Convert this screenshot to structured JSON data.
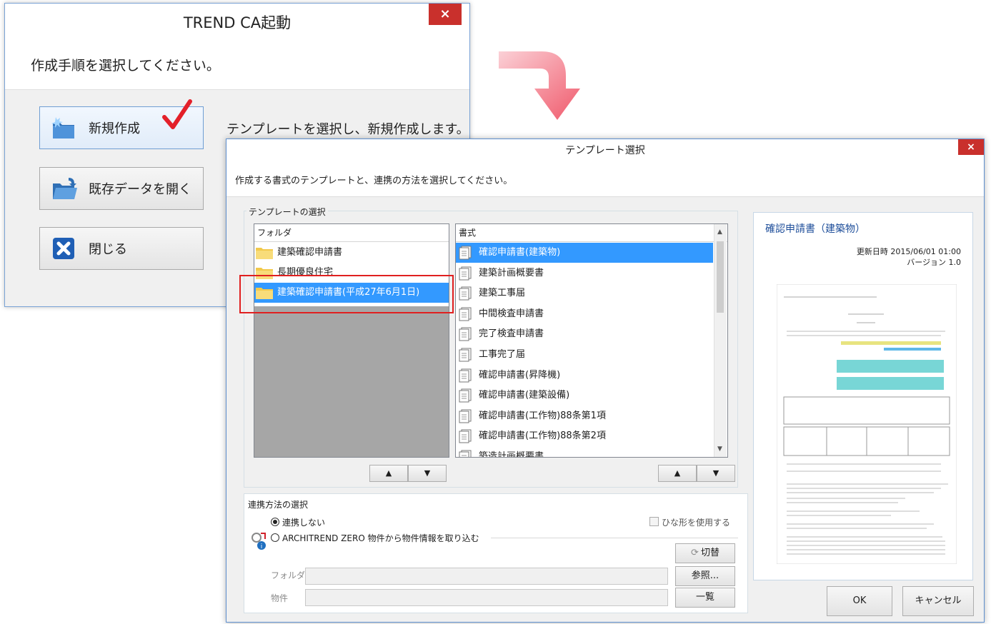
{
  "launcher": {
    "title": "TREND CA起動",
    "close_glyph": "×",
    "instruction": "作成手順を選択してください。",
    "new_label": "新規作成",
    "new_desc": "テンプレートを選択し、新規作成します。",
    "open_label": "既存データを開く",
    "close_label": "閉じる"
  },
  "template_dialog": {
    "title": "テンプレート選択",
    "close_glyph": "×",
    "instruction": "作成する書式のテンプレートと、連携の方法を選択してください。",
    "template_group_label": "テンプレートの選択",
    "folder_header": "フォルダ",
    "folders": [
      "建築確認申請書",
      "長期優良住宅",
      "建築確認申請書(平成27年6月1日)"
    ],
    "format_header": "書式",
    "formats": [
      "確認申請書(建築物)",
      "建築計画概要書",
      "建築工事届",
      "中間検査申請書",
      "完了検査申請書",
      "工事完了届",
      "確認申請書(昇降機)",
      "確認申請書(建築設備)",
      "確認申請書(工作物)88条第1項",
      "確認申請書(工作物)88条第2項",
      "築造計画概要書"
    ],
    "up_glyph": "▲",
    "down_glyph": "▼",
    "link_group_label": "連携方法の選択",
    "radio_no_link": "連携しない",
    "radio_architrend": "ARCHITREND ZERO 物件から物件情報を取り込む",
    "checkbox_hinagata": "ひな形を使用する",
    "switch_label": "切替",
    "folder_label": "フォルダ",
    "browse_label": "参照...",
    "property_label": "物件",
    "list_label": "一覧",
    "preview": {
      "title": "確認申請書（建築物）",
      "updated": "更新日時 2015/06/01 01:00",
      "version": "バージョン 1.0"
    },
    "ok_label": "OK",
    "cancel_label": "キャンセル"
  },
  "colors": {
    "selection": "#3399ff",
    "close_red": "#c9302c",
    "highlight_box": "#e02020",
    "check_mark": "#e3202a",
    "arrow": "#f26b7a"
  }
}
